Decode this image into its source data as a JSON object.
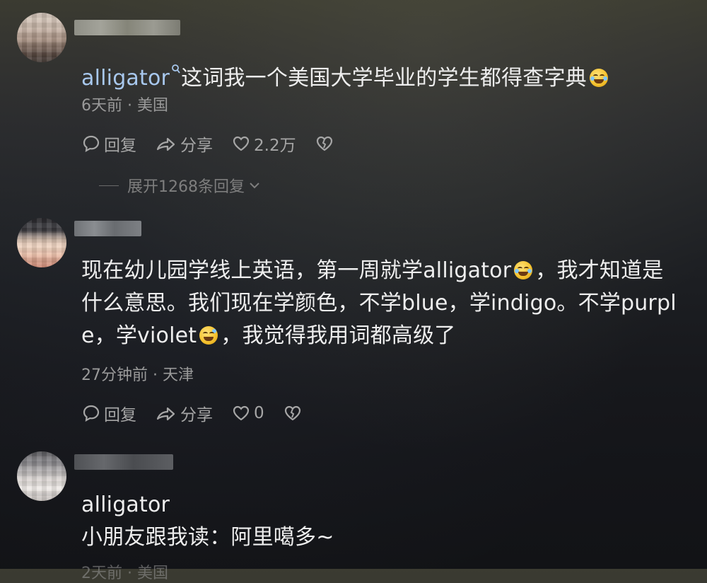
{
  "comments": [
    {
      "username_blurred": true,
      "link_word": "alligator",
      "text_after": "这词我一个美国大学毕业的学生都得查字典",
      "time": "6天前",
      "location": "美国",
      "actions": {
        "reply": "回复",
        "share": "分享",
        "likes": "2.2万"
      },
      "expand": "展开1268条回复"
    },
    {
      "username_blurred": true,
      "lines": [
        {
          "before": "现在幼儿园学线上英语，第一周就学alligator",
          "after": "，我才知道是"
        },
        {
          "before": "什么意思。我们现在学颜色，不学blue，学indigo。不学purpl",
          "after": ""
        },
        {
          "before": "e，学violet",
          "after": "，我觉得我用词都高级了"
        }
      ],
      "time": "27分钟前",
      "location": "天津",
      "actions": {
        "reply": "回复",
        "share": "分享",
        "likes": "0"
      }
    },
    {
      "username_blurred": true,
      "lines": [
        "alligator",
        "小朋友跟我读：阿里噶多~"
      ],
      "time": "2天前",
      "location": "美国"
    }
  ]
}
